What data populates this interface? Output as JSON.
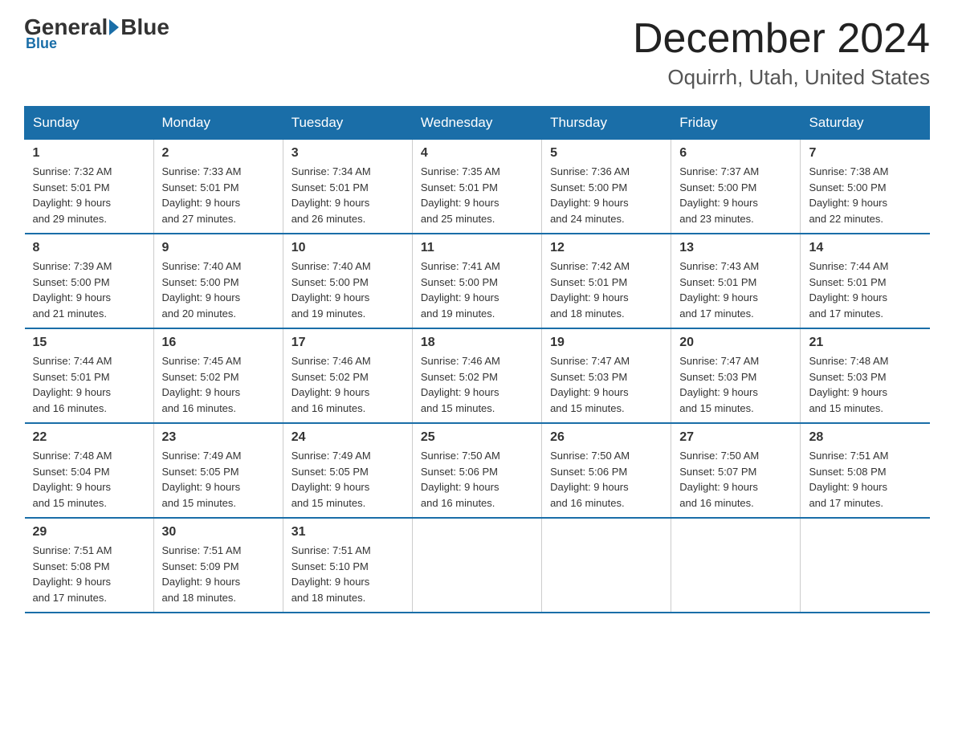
{
  "logo": {
    "general": "General",
    "blue": "Blue"
  },
  "title": "December 2024",
  "location": "Oquirrh, Utah, United States",
  "days_of_week": [
    "Sunday",
    "Monday",
    "Tuesday",
    "Wednesday",
    "Thursday",
    "Friday",
    "Saturday"
  ],
  "weeks": [
    [
      {
        "day": "1",
        "sunrise": "7:32 AM",
        "sunset": "5:01 PM",
        "daylight": "9 hours and 29 minutes."
      },
      {
        "day": "2",
        "sunrise": "7:33 AM",
        "sunset": "5:01 PM",
        "daylight": "9 hours and 27 minutes."
      },
      {
        "day": "3",
        "sunrise": "7:34 AM",
        "sunset": "5:01 PM",
        "daylight": "9 hours and 26 minutes."
      },
      {
        "day": "4",
        "sunrise": "7:35 AM",
        "sunset": "5:01 PM",
        "daylight": "9 hours and 25 minutes."
      },
      {
        "day": "5",
        "sunrise": "7:36 AM",
        "sunset": "5:00 PM",
        "daylight": "9 hours and 24 minutes."
      },
      {
        "day": "6",
        "sunrise": "7:37 AM",
        "sunset": "5:00 PM",
        "daylight": "9 hours and 23 minutes."
      },
      {
        "day": "7",
        "sunrise": "7:38 AM",
        "sunset": "5:00 PM",
        "daylight": "9 hours and 22 minutes."
      }
    ],
    [
      {
        "day": "8",
        "sunrise": "7:39 AM",
        "sunset": "5:00 PM",
        "daylight": "9 hours and 21 minutes."
      },
      {
        "day": "9",
        "sunrise": "7:40 AM",
        "sunset": "5:00 PM",
        "daylight": "9 hours and 20 minutes."
      },
      {
        "day": "10",
        "sunrise": "7:40 AM",
        "sunset": "5:00 PM",
        "daylight": "9 hours and 19 minutes."
      },
      {
        "day": "11",
        "sunrise": "7:41 AM",
        "sunset": "5:00 PM",
        "daylight": "9 hours and 19 minutes."
      },
      {
        "day": "12",
        "sunrise": "7:42 AM",
        "sunset": "5:01 PM",
        "daylight": "9 hours and 18 minutes."
      },
      {
        "day": "13",
        "sunrise": "7:43 AM",
        "sunset": "5:01 PM",
        "daylight": "9 hours and 17 minutes."
      },
      {
        "day": "14",
        "sunrise": "7:44 AM",
        "sunset": "5:01 PM",
        "daylight": "9 hours and 17 minutes."
      }
    ],
    [
      {
        "day": "15",
        "sunrise": "7:44 AM",
        "sunset": "5:01 PM",
        "daylight": "9 hours and 16 minutes."
      },
      {
        "day": "16",
        "sunrise": "7:45 AM",
        "sunset": "5:02 PM",
        "daylight": "9 hours and 16 minutes."
      },
      {
        "day": "17",
        "sunrise": "7:46 AM",
        "sunset": "5:02 PM",
        "daylight": "9 hours and 16 minutes."
      },
      {
        "day": "18",
        "sunrise": "7:46 AM",
        "sunset": "5:02 PM",
        "daylight": "9 hours and 15 minutes."
      },
      {
        "day": "19",
        "sunrise": "7:47 AM",
        "sunset": "5:03 PM",
        "daylight": "9 hours and 15 minutes."
      },
      {
        "day": "20",
        "sunrise": "7:47 AM",
        "sunset": "5:03 PM",
        "daylight": "9 hours and 15 minutes."
      },
      {
        "day": "21",
        "sunrise": "7:48 AM",
        "sunset": "5:03 PM",
        "daylight": "9 hours and 15 minutes."
      }
    ],
    [
      {
        "day": "22",
        "sunrise": "7:48 AM",
        "sunset": "5:04 PM",
        "daylight": "9 hours and 15 minutes."
      },
      {
        "day": "23",
        "sunrise": "7:49 AM",
        "sunset": "5:05 PM",
        "daylight": "9 hours and 15 minutes."
      },
      {
        "day": "24",
        "sunrise": "7:49 AM",
        "sunset": "5:05 PM",
        "daylight": "9 hours and 15 minutes."
      },
      {
        "day": "25",
        "sunrise": "7:50 AM",
        "sunset": "5:06 PM",
        "daylight": "9 hours and 16 minutes."
      },
      {
        "day": "26",
        "sunrise": "7:50 AM",
        "sunset": "5:06 PM",
        "daylight": "9 hours and 16 minutes."
      },
      {
        "day": "27",
        "sunrise": "7:50 AM",
        "sunset": "5:07 PM",
        "daylight": "9 hours and 16 minutes."
      },
      {
        "day": "28",
        "sunrise": "7:51 AM",
        "sunset": "5:08 PM",
        "daylight": "9 hours and 17 minutes."
      }
    ],
    [
      {
        "day": "29",
        "sunrise": "7:51 AM",
        "sunset": "5:08 PM",
        "daylight": "9 hours and 17 minutes."
      },
      {
        "day": "30",
        "sunrise": "7:51 AM",
        "sunset": "5:09 PM",
        "daylight": "9 hours and 18 minutes."
      },
      {
        "day": "31",
        "sunrise": "7:51 AM",
        "sunset": "5:10 PM",
        "daylight": "9 hours and 18 minutes."
      },
      {
        "day": "",
        "sunrise": "",
        "sunset": "",
        "daylight": ""
      },
      {
        "day": "",
        "sunrise": "",
        "sunset": "",
        "daylight": ""
      },
      {
        "day": "",
        "sunrise": "",
        "sunset": "",
        "daylight": ""
      },
      {
        "day": "",
        "sunrise": "",
        "sunset": "",
        "daylight": ""
      }
    ]
  ],
  "labels": {
    "sunrise": "Sunrise: ",
    "sunset": "Sunset: ",
    "daylight": "Daylight: "
  }
}
